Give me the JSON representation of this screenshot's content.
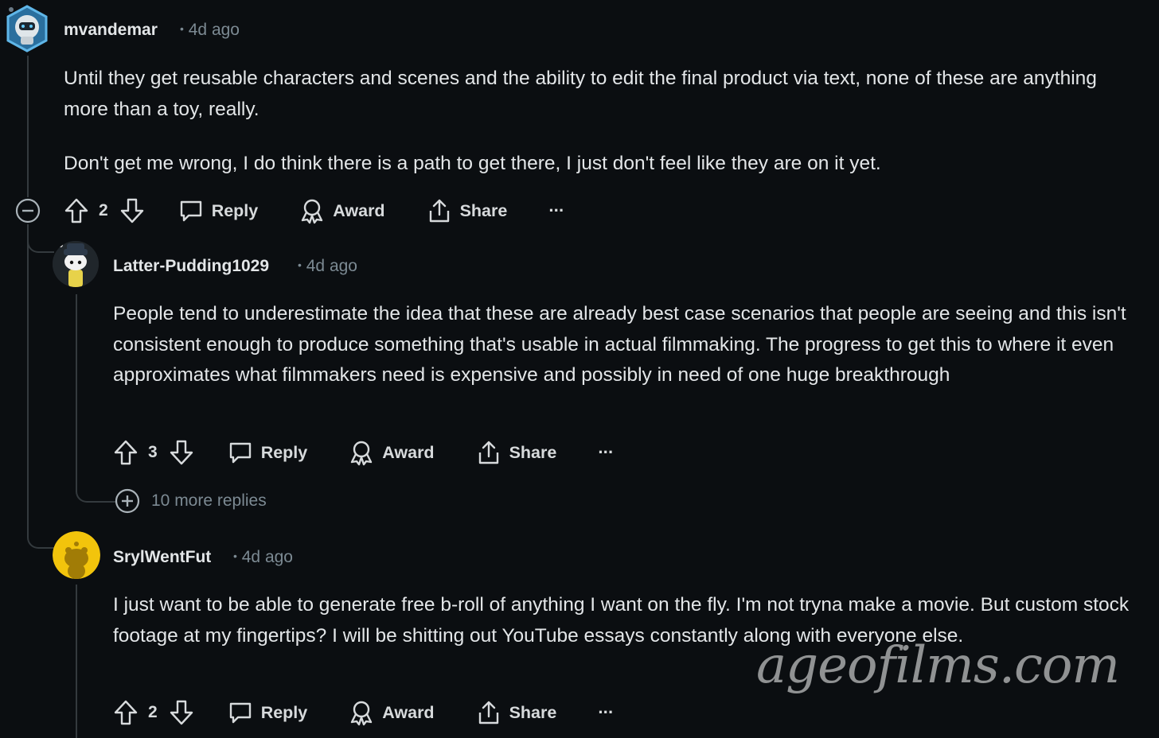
{
  "comments": [
    {
      "username": "mvandemar",
      "time": "4d ago",
      "paragraphs": [
        "Until they get reusable characters and scenes and the ability to edit the final product via text, none of these are anything more than a toy, really.",
        "Don't get me wrong, I do think there is a path to get there, I just don't feel like they are on it yet."
      ],
      "votes": "2"
    },
    {
      "username": "Latter-Pudding1029",
      "time": "4d ago",
      "paragraphs": [
        "People tend to underestimate the idea that these are already best case scenarios that people are seeing and this isn't consistent enough to produce something that's usable in actual filmmaking. The progress to get this to where it even approximates what filmmakers need is expensive and possibly in need of one huge breakthrough"
      ],
      "votes": "3",
      "more_replies": "10 more replies"
    },
    {
      "username": "SrylWentFut",
      "time": "4d ago",
      "paragraphs": [
        "I just want to be able to generate free b-roll of anything I want on the fly. I'm not tryna make a movie. But custom stock footage at my fingertips? I will be shitting out YouTube essays constantly along with everyone else."
      ],
      "votes": "2"
    }
  ],
  "actions": {
    "reply": "Reply",
    "award": "Award",
    "share": "Share",
    "more": "···"
  },
  "separator": "•",
  "watermark": "ageofilms.com",
  "colors": {
    "background": "#0b0e11",
    "text": "#e3e6e8",
    "muted": "#7c8a93",
    "thread_line": "#343a3e"
  }
}
